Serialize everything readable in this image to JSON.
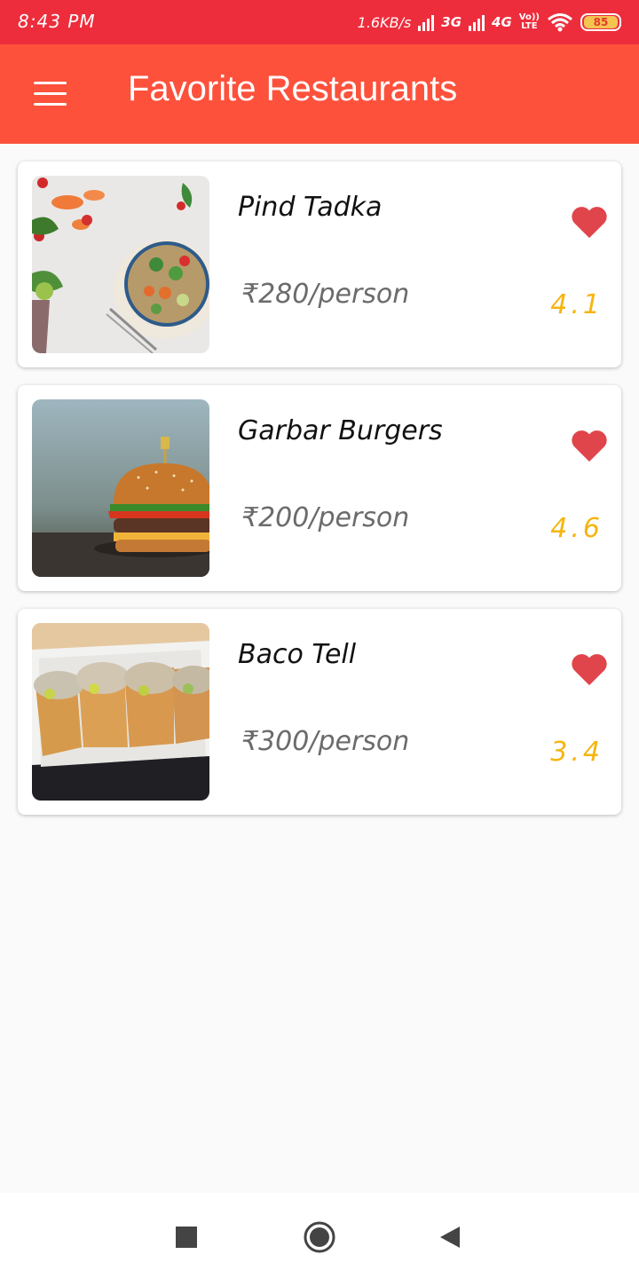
{
  "status_bar": {
    "time": "8:43 PM",
    "speed": "1.6KB/s",
    "net1": "3G",
    "net2": "4G",
    "volte_top": "Vo))",
    "volte_bottom": "LTE",
    "battery": "85"
  },
  "appbar": {
    "title": "Favorite Restaurants",
    "menu_icon": "hamburger-menu-icon"
  },
  "restaurants": [
    {
      "name": "Pind Tadka",
      "price": "₹280/person",
      "rating": "4.1",
      "favorite": true,
      "image": "salad-bowl-photo"
    },
    {
      "name": "Garbar Burgers",
      "price": "₹200/person",
      "rating": "4.6",
      "favorite": true,
      "image": "burger-photo"
    },
    {
      "name": "Baco Tell",
      "price": "₹300/person",
      "rating": "3.4",
      "favorite": true,
      "image": "tacos-photo"
    }
  ],
  "colors": {
    "status_bar": "#ed2d3c",
    "appbar": "#fd513c",
    "heart": "#e0454b",
    "rating": "#f6b50f"
  },
  "navbar": {
    "recents_icon": "square-recents-icon",
    "home_icon": "circle-home-icon",
    "back_icon": "triangle-back-icon"
  }
}
